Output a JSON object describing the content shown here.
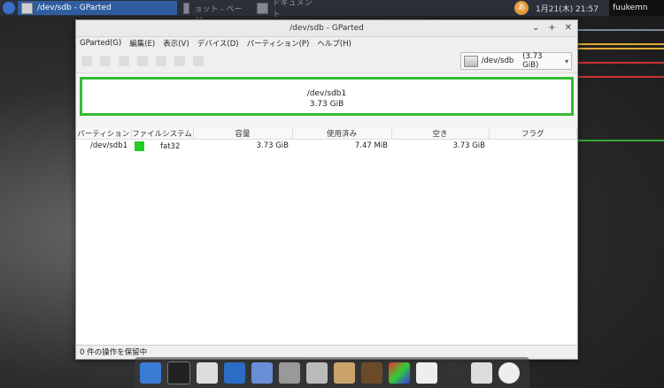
{
  "top_panel": {
    "active_task": "/dev/sdb - GParted",
    "inactive_tasks": [
      "スクリーンショット - ページ",
      "ドキュメント"
    ],
    "im_label": "あ",
    "clock": "1月21(木) 21:57",
    "user": "fuukemn"
  },
  "window": {
    "title": "/dev/sdb - GParted",
    "controls": [
      "⌄",
      "+",
      "✕"
    ],
    "menu": [
      "GParted(G)",
      "編集(E)",
      "表示(V)",
      "デバイス(D)",
      "パーティション(P)",
      "ヘルプ(H)"
    ],
    "device_selector": {
      "name": "/dev/sdb",
      "size": "(3.73 GiB)"
    },
    "visual_partition": {
      "name": "/dev/sdb1",
      "size": "3.73 GiB"
    },
    "table": {
      "headers": [
        "パーティション",
        "ファイルシステム",
        "容量",
        "使用済み",
        "空き",
        "フラグ"
      ],
      "rows": [
        {
          "partition": "/dev/sdb1",
          "filesystem": "fat32",
          "size": "3.73 GiB",
          "used": "7.47 MiB",
          "free": "3.73 GiB",
          "flags": ""
        }
      ]
    },
    "status": "0 件の操作を保留中"
  },
  "colors": {
    "fat32": "#22cc22",
    "accent_border": "#33bb33",
    "active_task": "#2f5d9f"
  },
  "dock_icons": [
    "file-manager-icon",
    "terminal-icon",
    "text-editor-icon",
    "settings-icon",
    "image-viewer-icon",
    "archive-icon",
    "search-icon",
    "package-icon",
    "media-icon",
    "paint-icon",
    "font-icon",
    "disk-icon",
    "trash-icon",
    "restart-icon"
  ]
}
